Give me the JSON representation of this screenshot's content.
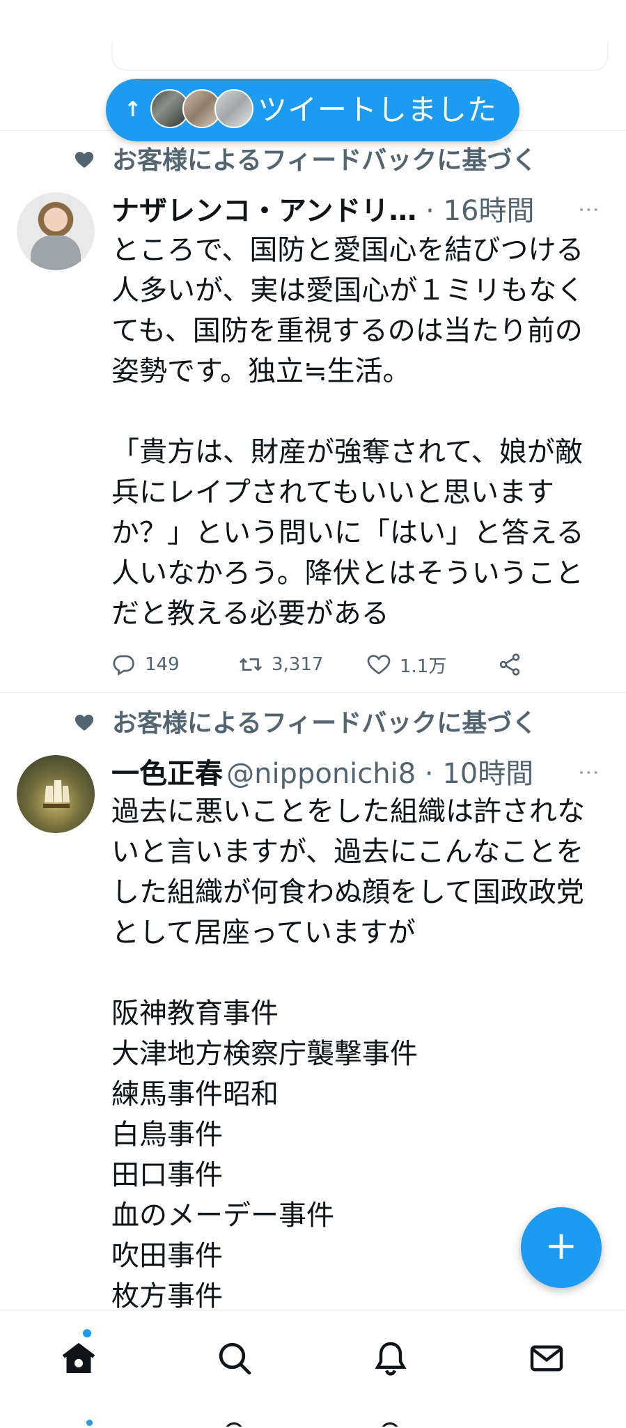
{
  "toast": {
    "arrow": "↑",
    "text": "ツイートしました"
  },
  "tweets": [
    {
      "social_context": "お客様によるフィードバックに基づく",
      "name": "ナザレンコ・アンドリ…",
      "handle": "",
      "separator": " · ",
      "time": "16時間",
      "text": "ところで、国防と愛国心を結びつける人多いが、実は愛国心が１ミリもなくても、国防を重視するのは当たり前の姿勢です。独立≒生活。\n\n「貴方は、財産が強奪されて、娘が敵兵にレイプされてもいいと思いますか？」という問いに「はい」と答える人いなかろう。降伏とはそういうことだと教える必要がある",
      "replies": "149",
      "retweets": "3,317",
      "likes": "1.1万"
    },
    {
      "social_context": "お客様によるフィードバックに基づく",
      "name": "一色正春",
      "handle": "@nipponichi8",
      "separator": " · ",
      "time": "10時間",
      "text": "過去に悪いことをした組織は許されないと言いますが、過去にこんなことをした組織が何食わぬ顔をして国政政党として居座っていますが\n\n阪神教育事件\n大津地方検察庁襲撃事件\n練馬事件昭和\n白鳥事件\n田口事件\n血のメーデー事件\n吹田事件\n枚方事件"
    }
  ],
  "fab": {
    "icon": "+"
  },
  "colors": {
    "accent": "#1d9bf0",
    "text": "#0f1419",
    "secondary": "#536471",
    "divider": "#eff3f4"
  }
}
